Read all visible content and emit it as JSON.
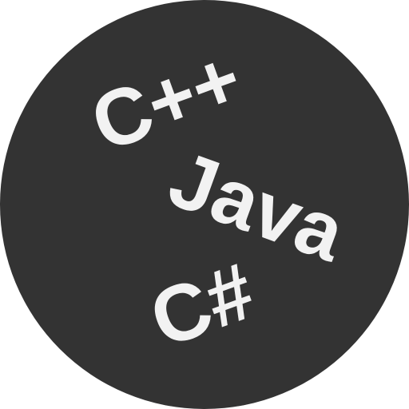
{
  "colors": {
    "badge": "#333333",
    "text": "#f2f2f2",
    "background": "#ffffff"
  },
  "labels": {
    "cpp": "C++",
    "java": "Java",
    "csharp": "C#"
  }
}
